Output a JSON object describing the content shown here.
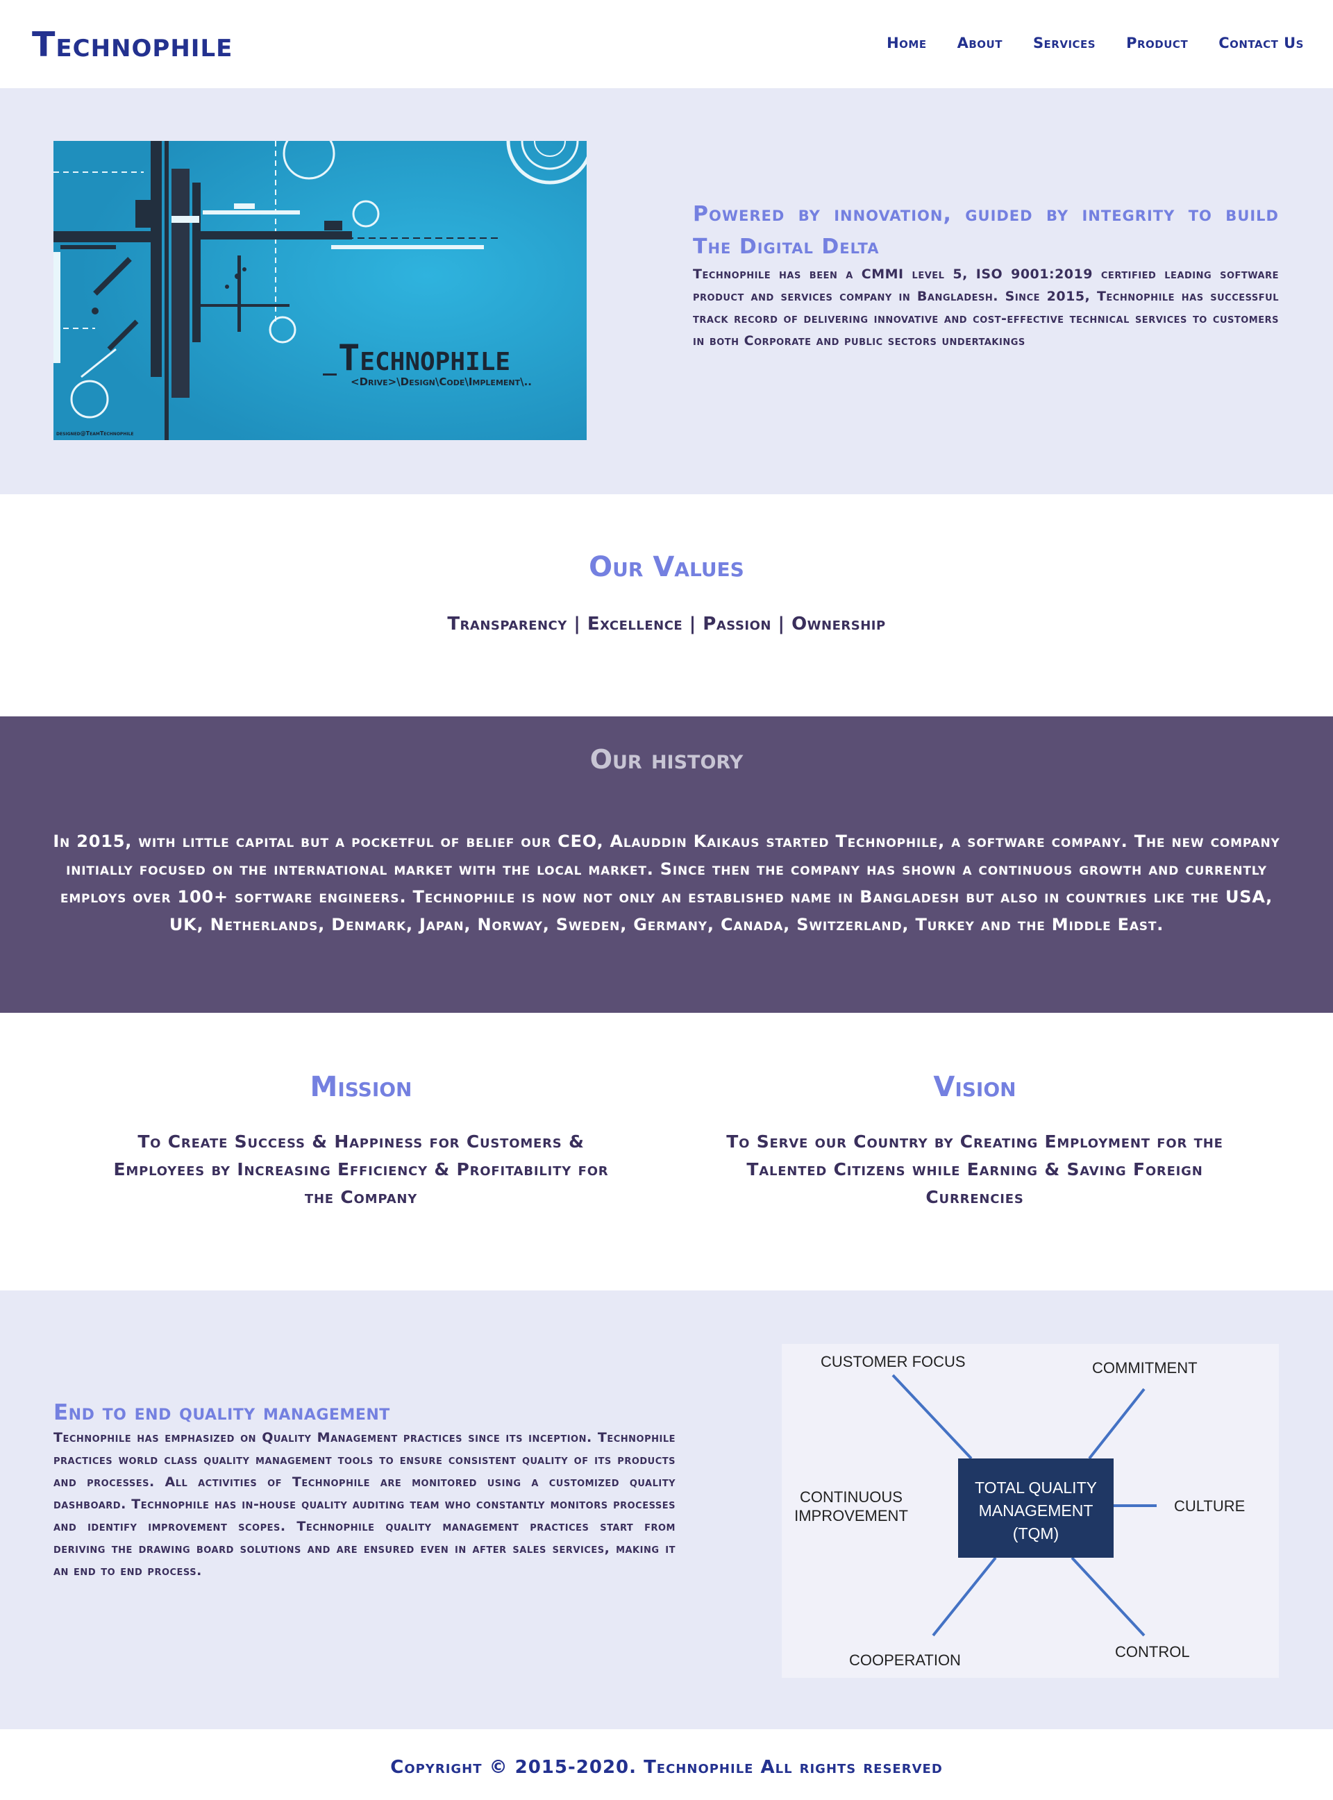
{
  "nav": {
    "brand": "Technophile",
    "links": [
      "Home",
      "About",
      "Services",
      "Product",
      "Contact Us"
    ]
  },
  "hero": {
    "image": {
      "brand_text": "Technophile",
      "tagline": "<Drive>\\Design\\Code\\Implement\\..",
      "credit": "designed@TeamTechnophile"
    },
    "title": "Powered by innovation, guided by integrity to build The Digital Delta",
    "body": "Technophile has been a CMMI level 5, ISO 9001:2019 certified leading software product and services company in Bangladesh. Since 2015, Technophile has successful track record of delivering innovative and cost-effective technical services to customers in both Corporate and public sectors undertakings"
  },
  "values": {
    "title": "Our Values",
    "list": "Transparency | Excellence | Passion | Ownership"
  },
  "history": {
    "title": "Our history",
    "body": "In 2015, with little capital but a pocketful of belief our CEO, Alauddin Kaikaus started Technophile, a software company. The new company initially focused on the international market with the local market. Since then the company has shown a continuous growth and currently employs over 100+ software engineers. Technophile is now not only an established name in Bangladesh but also in countries like the USA, UK, Netherlands, Denmark, Japan, Norway, Sweden, Germany, Canada, Switzerland, Turkey and the Middle East."
  },
  "mission": {
    "title": "Mission",
    "text": "To Create Success & Happiness for Customers & Employees by Increasing Efficiency & Profitability for the Company"
  },
  "vision": {
    "title": "Vision",
    "text": "To Serve our Country by Creating Employment for the Talented Citizens while Earning & Saving Foreign Currencies"
  },
  "quality": {
    "title": "End to end quality management",
    "body": "Technophile has emphasized on Quality Management practices since its inception. Technophile practices world class quality management tools to ensure consistent quality of its products and processes. All activities of Technophile are monitored using a customized quality dashboard. Technophile has in-house quality auditing team who constantly monitors processes and identify improvement scopes. Technophile quality management practices start from deriving the drawing board solutions and are ensured even in after sales services, making it an end to end process.",
    "diagram": {
      "center_line1": "TOTAL QUALITY",
      "center_line2": "MANAGEMENT",
      "center_line3": "(TQM)",
      "customer_focus": "CUSTOMER FOCUS",
      "commitment": "COMMITMENT",
      "continuous_line1": "CONTINUOUS",
      "continuous_line2": "IMPROVEMENT",
      "culture": "CULTURE",
      "cooperation": "COOPERATION",
      "control": "CONTROL"
    }
  },
  "footer": {
    "text": "Copyright © 2015-2020. Technophile All rights reserved"
  },
  "colors": {
    "brand_blue": "#23318f",
    "accent_periwinkle": "#7480e0",
    "dark_purple_text": "#3a2f5c",
    "history_bg": "#5b4f74",
    "light_section_bg": "#e7e9f6",
    "hero_image_blue": "#27a3cf",
    "tqm_box": "#1f3764"
  }
}
